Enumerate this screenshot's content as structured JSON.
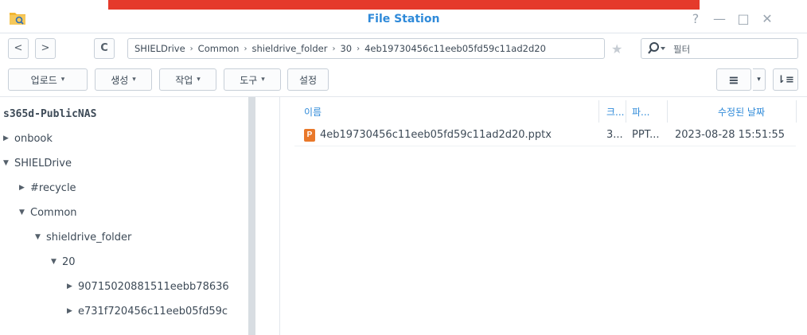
{
  "window": {
    "title": "File Station",
    "controls": {
      "help": "?",
      "minimize": "—",
      "maximize": "□",
      "close": "✕"
    }
  },
  "nav": {
    "back": "<",
    "forward": ">",
    "refresh": "C",
    "path": [
      "SHIELDrive",
      "Common",
      "shieldrive_folder",
      "30",
      "4eb19730456c11eeb05fd59c11ad2d20"
    ],
    "path_sep": "›",
    "star": "★",
    "filter_caret": "▾",
    "filter_placeholder": "필터"
  },
  "toolbar": {
    "upload": "업로드",
    "create": "생성",
    "action": "작업",
    "tools": "도구",
    "settings": "설정",
    "caret": "▾",
    "view_list": "≡",
    "view_caret": "▾",
    "sort": "⇂≡"
  },
  "sidebar": {
    "root": "s365d-PublicNAS",
    "items": [
      {
        "label": "onbook",
        "state": "collapsed"
      },
      {
        "label": "SHIELDrive",
        "state": "expanded"
      },
      {
        "label": "#recycle",
        "state": "collapsed"
      },
      {
        "label": "Common",
        "state": "expanded"
      },
      {
        "label": "shieldrive_folder",
        "state": "expanded"
      },
      {
        "label": "20",
        "state": "expanded"
      },
      {
        "label": "90715020881511eebb78636",
        "state": "collapsed"
      },
      {
        "label": "e731f720456c11eeb05fd59c",
        "state": "collapsed"
      }
    ],
    "tri_collapsed": "▶",
    "tri_expanded": "▼"
  },
  "file_list": {
    "columns": {
      "name": "이름",
      "size": "크...",
      "type": "파...",
      "modified": "수정된 날짜"
    },
    "rows": [
      {
        "icon_letter": "P",
        "name": "4eb19730456c11eeb05fd59c11ad2d20.pptx",
        "size": "3...",
        "type": "PPT...",
        "modified": "2023-08-28 15:51:55"
      }
    ]
  }
}
